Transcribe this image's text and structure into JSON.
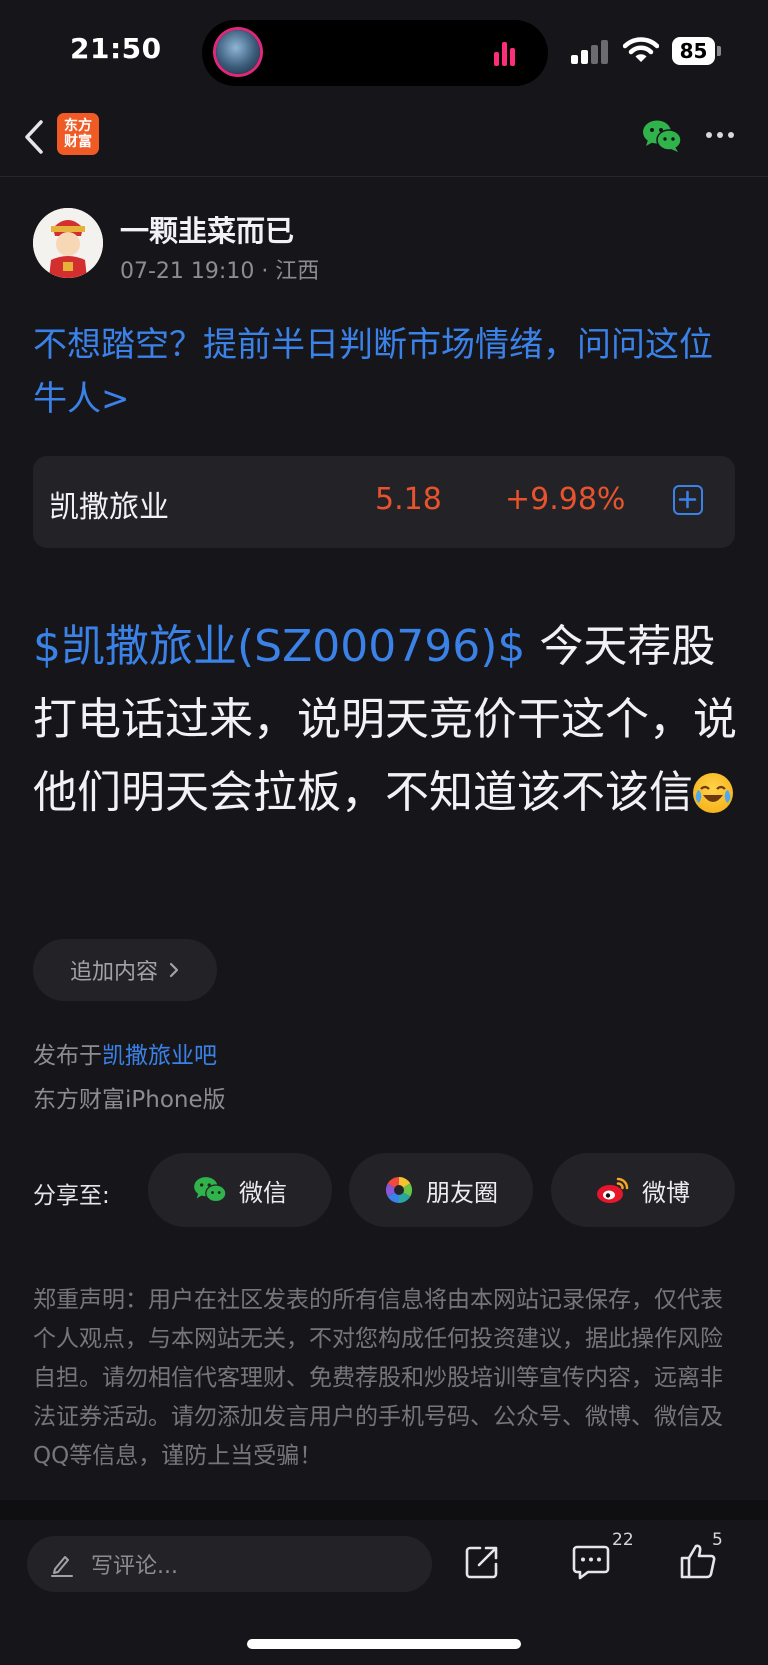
{
  "status_bar": {
    "time": "21:50",
    "battery": "85"
  },
  "nav": {
    "logo_line1": "东方",
    "logo_line2": "财富"
  },
  "author": {
    "name": "一颗韭菜而已",
    "meta": "07-21 19:10 · 江西"
  },
  "promo": {
    "text": "不想踏空？提前半日判断市场情绪，问问这位牛人>"
  },
  "stock": {
    "name": "凯撒旅业",
    "price": "5.18",
    "change": "+9.98%",
    "change_color": "#e8532d"
  },
  "post": {
    "tag": "$凯撒旅业(SZ000796)$",
    "body": "  今天荐股打电话过来，说明天竞价干这个，说他们明天会拉板，不知道该不该信",
    "emoji": "laughing-crying-emoji"
  },
  "append_button": {
    "label": "追加内容"
  },
  "published": {
    "prefix": "发布于",
    "bar": "凯撒旅业吧",
    "client": "东方财富iPhone版"
  },
  "share": {
    "label": "分享至:",
    "wechat": "微信",
    "moments": "朋友圈",
    "weibo": "微博"
  },
  "disclaimer": "郑重声明：用户在社区发表的所有信息将由本网站记录保存，仅代表个人观点，与本网站无关，不对您构成任何投资建议，据此操作风险自担。请勿相信代客理财、免费荐股和炒股培训等宣传内容，远离非法证券活动。请勿添加发言用户的手机号码、公众号、微博、微信及QQ等信息，谨防上当受骗！",
  "bottom_bar": {
    "comment_placeholder": "写评论...",
    "comment_count": "22",
    "like_count": "5"
  },
  "colors": {
    "accent_blue": "#3b82e8",
    "stock_up": "#e8532d",
    "background": "#16161a"
  }
}
